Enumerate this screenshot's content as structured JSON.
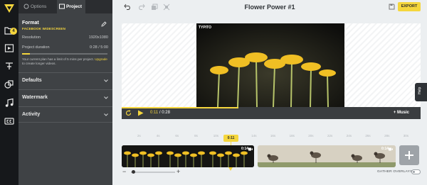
{
  "tabs": {
    "options": "Options",
    "project": "Project"
  },
  "format": {
    "title": "Format",
    "subtitle": "FACEBOOK WIDESCREEN",
    "resolution_label": "Resolution",
    "resolution_value": "1920x1080",
    "duration_label": "Project duration",
    "duration_value": "0:28 / 5:00",
    "duration_fraction": 0.09,
    "limit_text": "Your current plan has a limit of 5 mins per project.",
    "upgrade_link": "Upgrade",
    "limit_tail": "to create longer videos."
  },
  "sections": {
    "defaults": "Defaults",
    "watermark": "Watermark",
    "activity": "Activity"
  },
  "rail": {
    "badge": "4"
  },
  "header": {
    "title": "Flower Power #1",
    "export_label": "EXPORT"
  },
  "preview": {
    "watermark": "TYPITO"
  },
  "help": {
    "label": "Help"
  },
  "player": {
    "current": "0:11",
    "separator": " / ",
    "total": "0:28",
    "progress_fraction": 0.39,
    "music_label": "+ Music"
  },
  "timeline": {
    "ticks": [
      "2s",
      "4s",
      "6s",
      "8s",
      "10s",
      "12s",
      "14s",
      "16s",
      "18s",
      "20s",
      "22s",
      "24s",
      "26s",
      "28s",
      "30s"
    ],
    "cursor_label": "0:11",
    "clips": [
      {
        "duration": "0:14"
      },
      {
        "duration": "0:14"
      }
    ],
    "zoom_minus": "−",
    "zoom_plus": "+",
    "gather_label": "GATHER OVERLAYS"
  },
  "colors": {
    "accent": "#f5d63d",
    "panel": "#3f4245",
    "rail": "#16181b"
  }
}
